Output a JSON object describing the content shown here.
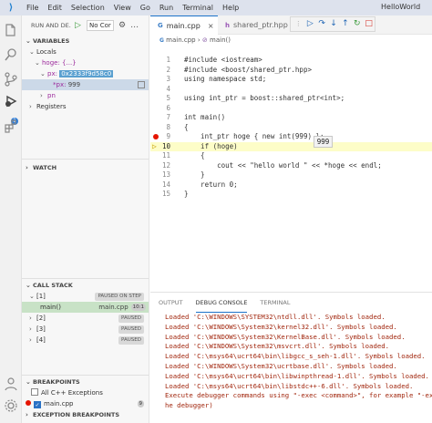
{
  "titlebar": {
    "menu": [
      "File",
      "Edit",
      "Selection",
      "View",
      "Go",
      "Run",
      "Terminal",
      "Help"
    ],
    "window_title": "HelloWorld"
  },
  "sidebar": {
    "run_title": "RUN AND DE...",
    "config_value": "No Cor",
    "variables_header": "VARIABLES",
    "locals_label": "Locals",
    "hoge_label": "hoge: {...}",
    "px_name": "px:",
    "px_addr": "0x2333f9d58c0",
    "deref_name": "*px:",
    "deref_val": "999",
    "pn_label": "pn",
    "registers_label": "Registers",
    "watch_header": "WATCH",
    "callstack_header": "CALL STACK",
    "threads": [
      {
        "label": "[1]",
        "badge": "PAUSED ON STEP"
      },
      {
        "label": "[2]",
        "badge": "PAUSED"
      },
      {
        "label": "[3]",
        "badge": "PAUSED"
      },
      {
        "label": "[4]",
        "badge": "PAUSED"
      }
    ],
    "frame_label": "main()",
    "frame_file": "main.cpp",
    "frame_line": "10:1",
    "breakpoints_header": "BREAKPOINTS",
    "bp_all_exceptions": "All C++ Exceptions",
    "bp_file": "main.cpp",
    "bp_count": "9",
    "exception_bp_header": "EXCEPTION BREAKPOINTS"
  },
  "tabs": [
    {
      "label": "main.cpp",
      "active": true
    },
    {
      "label": "shared_ptr.hpp",
      "active": false
    }
  ],
  "breadcrumb": {
    "file": "main.cpp",
    "symbol": "main()"
  },
  "editor": {
    "lines": [
      {
        "n": "1",
        "code": "#include <iostream>"
      },
      {
        "n": "2",
        "code": "#include <boost/shared_ptr.hpp>"
      },
      {
        "n": "3",
        "code": "using namespace std;"
      },
      {
        "n": "4",
        "code": ""
      },
      {
        "n": "5",
        "code": "using int_ptr = boost::shared_ptr<int>;"
      },
      {
        "n": "6",
        "code": ""
      },
      {
        "n": "7",
        "code": "int main()"
      },
      {
        "n": "8",
        "code": "{"
      },
      {
        "n": "9",
        "code": "    int_ptr hoge { new int(999) };"
      },
      {
        "n": "10",
        "code": "    if (hoge)"
      },
      {
        "n": "11",
        "code": "    {"
      },
      {
        "n": "12",
        "code": "        cout << \"hello world \" << *hoge << endl;"
      },
      {
        "n": "13",
        "code": "    }"
      },
      {
        "n": "14",
        "code": "    return 0;"
      },
      {
        "n": "15",
        "code": "}"
      }
    ],
    "hover_value": "999"
  },
  "panel": {
    "tabs": [
      "OUTPUT",
      "DEBUG CONSOLE",
      "TERMINAL"
    ],
    "console_lines": [
      "Loaded 'C:\\WINDOWS\\SYSTEM32\\ntdll.dll'. Symbols loaded.",
      "Loaded 'C:\\WINDOWS\\System32\\kernel32.dll'. Symbols loaded.",
      "Loaded 'C:\\WINDOWS\\System32\\KernelBase.dll'. Symbols loaded.",
      "Loaded 'C:\\WINDOWS\\System32\\msvcrt.dll'. Symbols loaded.",
      "Loaded 'C:\\msys64\\ucrt64\\bin\\libgcc_s_seh-1.dll'. Symbols loaded.",
      "Loaded 'C:\\WINDOWS\\System32\\ucrtbase.dll'. Symbols loaded.",
      "Loaded 'C:\\msys64\\ucrt64\\bin\\libwinpthread-1.dll'. Symbols loaded.",
      "Loaded 'C:\\msys64\\ucrt64\\bin\\libstdc++-6.dll'. Symbols loaded.",
      "Execute debugger commands using \"-exec <command>\", for example \"-exec",
      "he debugger)"
    ]
  }
}
